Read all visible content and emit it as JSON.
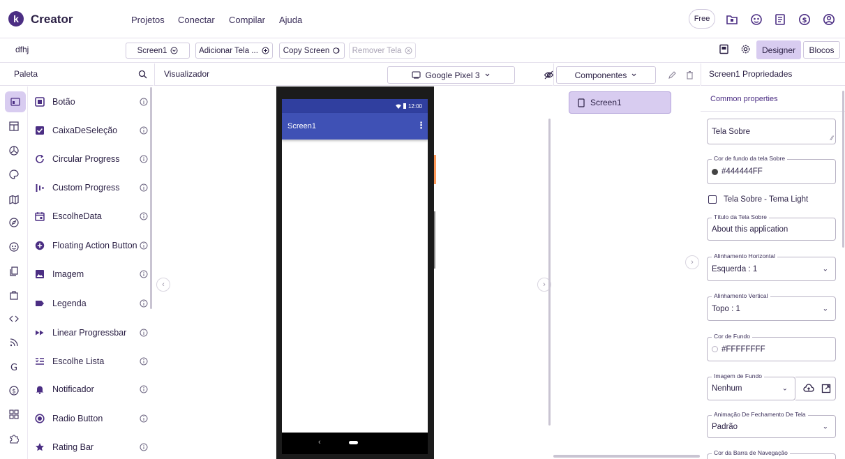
{
  "app": {
    "brand": "Creator",
    "logo_letter": "k",
    "menu": [
      "Projetos",
      "Conectar",
      "Compilar",
      "Ajuda"
    ],
    "plan_badge": "Free"
  },
  "project": {
    "name": "dfhj",
    "screen_select": "Screen1",
    "add_screen": "Adicionar Tela ...",
    "copy_screen": "Copy Screen",
    "remove_screen": "Remover Tela",
    "designer": "Designer",
    "blocks": "Blocos"
  },
  "palette": {
    "title": "Paleta",
    "items": [
      {
        "label": "Botão",
        "icon": "button-icon"
      },
      {
        "label": "CaixaDeSeleção",
        "icon": "checkbox-icon"
      },
      {
        "label": "Circular Progress",
        "icon": "circular-progress-icon"
      },
      {
        "label": "Custom Progress",
        "icon": "custom-progress-icon"
      },
      {
        "label": "EscolheData",
        "icon": "calendar-icon"
      },
      {
        "label": "Floating Action Button",
        "icon": "fab-icon"
      },
      {
        "label": "Imagem",
        "icon": "image-icon"
      },
      {
        "label": "Legenda",
        "icon": "label-icon"
      },
      {
        "label": "Linear Progressbar",
        "icon": "linear-progress-icon"
      },
      {
        "label": "Escolhe Lista",
        "icon": "list-picker-icon"
      },
      {
        "label": "Notificador",
        "icon": "bell-icon"
      },
      {
        "label": "Radio Button",
        "icon": "radio-icon"
      },
      {
        "label": "Rating Bar",
        "icon": "star-icon"
      }
    ]
  },
  "viewer": {
    "title": "Visualizador",
    "device": "Google Pixel 3",
    "status_time": "12:00",
    "screen_title": "Screen1"
  },
  "components": {
    "title": "Componentes",
    "items": [
      "Screen1"
    ]
  },
  "properties": {
    "title": "Screen1 Propriedades",
    "common": "Common properties",
    "about_text": "Tela Sobre",
    "about_bg_label": "Cor de fundo da tela Sobre",
    "about_bg_value": "#444444FF",
    "about_bg_color": "#444444",
    "light_theme_label": "Tela Sobre - Tema Light",
    "about_title_label": "Título da Tela Sobre",
    "about_title_value": "About this application",
    "align_h_label": "Alinhamento Horizontal",
    "align_h_value": "Esquerda : 1",
    "align_v_label": "Alinhamento Vertical",
    "align_v_value": "Topo : 1",
    "bg_label": "Cor de Fundo",
    "bg_value": "#FFFFFFFF",
    "bg_image_label": "Imagem de Fundo",
    "bg_image_value": "Nenhum",
    "close_anim_label": "Animação De Fechamento De Tela",
    "close_anim_value": "Padrão",
    "navbar_color_label": "Cor da Barra de Navegação"
  },
  "colors": {
    "accent": "#4b2e83",
    "selected": "#d8ccf0",
    "appbar": "#3f51b5",
    "statusbar": "#303f9f"
  }
}
